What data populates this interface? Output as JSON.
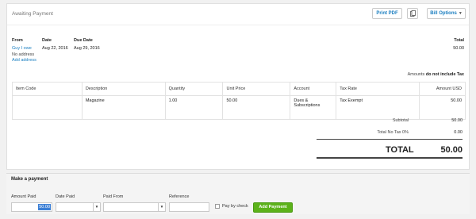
{
  "invoice": {
    "status": "Awaiting Payment",
    "buttons": {
      "print": "Print PDF",
      "bill_options": "Bill Options"
    },
    "headers": {
      "from": "From",
      "date": "Date",
      "due_date": "Due Date",
      "total": "Total"
    },
    "from_name": "Guy I owe",
    "no_address": "No address",
    "add_address": "Add address",
    "date": "Aug 22, 2016",
    "due_date": "Aug 29, 2016",
    "total": "50.00",
    "amounts_note_prefix": "Amounts",
    "amounts_note_bold": "do not include Tax"
  },
  "table": {
    "columns": [
      "Item Code",
      "Description",
      "Quantity",
      "Unit Price",
      "Account",
      "Tax Rate",
      "Amount USD"
    ],
    "rows": [
      {
        "item_code": "",
        "description": "Magazine",
        "quantity": "1.00",
        "unit_price": "50.00",
        "account": "Dues & Subscriptions",
        "tax_rate": "Tax Exempt",
        "amount": "50.00"
      }
    ]
  },
  "summary": {
    "subtotal_label": "Subtotal",
    "subtotal": "50.00",
    "tax_label": "Total No Tax 0%",
    "tax": "0.00",
    "total_label": "TOTAL",
    "total": "50.00"
  },
  "payment": {
    "title": "Make a payment",
    "labels": {
      "amount_paid": "Amount Paid",
      "date_paid": "Date Paid",
      "paid_from": "Paid From",
      "reference": "Reference"
    },
    "amount_paid": "50.00",
    "date_paid": "",
    "paid_from": "",
    "reference": "",
    "pay_by_check": "Pay by check",
    "add_button": "Add Payment"
  },
  "icons": {
    "copy": "copy-icon",
    "dropdown": "chevron-down-icon"
  },
  "colors": {
    "link": "#1a7ec0",
    "add_button": "#5cb21a",
    "selection": "#3b7fd6"
  }
}
